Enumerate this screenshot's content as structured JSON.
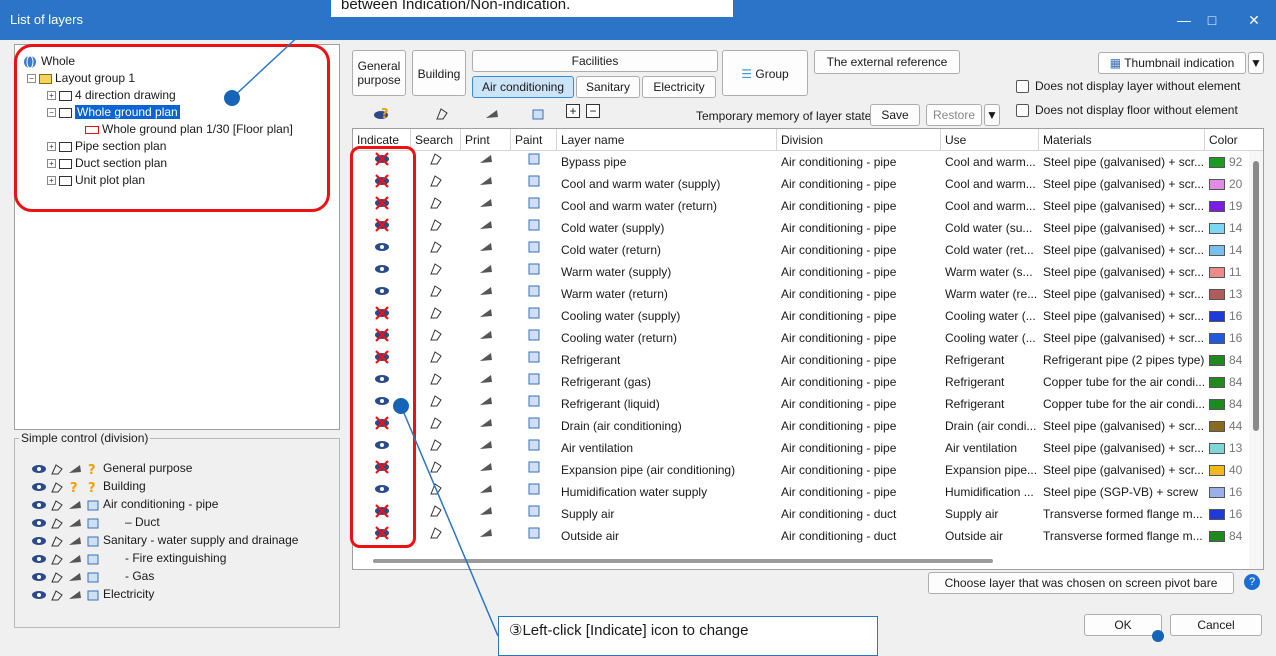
{
  "window": {
    "title": "List of layers",
    "minimize": "—",
    "maximize": "□",
    "close": "✕"
  },
  "callouts": {
    "top": "between Indication/Non-indication.",
    "bottom": "③Left-click [Indicate] icon to change"
  },
  "tree": {
    "items": [
      {
        "label": "Whole",
        "level": 0
      },
      {
        "label": "Layout group 1",
        "level": 1
      },
      {
        "label": "4 direction drawing",
        "level": 2
      },
      {
        "label": "Whole ground plan",
        "level": 2,
        "selected": true
      },
      {
        "label": "Whole ground plan 1/30 [Floor plan]",
        "level": 3
      },
      {
        "label": "Pipe section plan",
        "level": 2
      },
      {
        "label": "Duct section plan",
        "level": 2
      },
      {
        "label": "Unit plot plan",
        "level": 2
      }
    ]
  },
  "simple_control": {
    "legend": "Simple control (division)",
    "rows": [
      "General purpose",
      "Building",
      "Air conditioning - pipe",
      "– Duct",
      "Sanitary - water supply and drainage",
      "- Fire extinguishing",
      "- Gas",
      "Electricity"
    ]
  },
  "toolbar": {
    "general_purpose": "General purpose",
    "building": "Building",
    "facilities": "Facilities",
    "air_conditioning": "Air conditioning",
    "sanitary": "Sanitary",
    "electricity": "Electricity",
    "group": "Group",
    "external_reference": "The external reference",
    "thumbnail": "Thumbnail indication",
    "no_layer_without_element": "Does not display layer without element",
    "no_floor_without_element": "Does not display floor without element",
    "temp_memory": "Temporary memory of layer state",
    "save": "Save",
    "restore": "Restore"
  },
  "table": {
    "headers": [
      "Indicate",
      "Search",
      "Print",
      "Paint",
      "Layer name",
      "Division",
      "Use",
      "Materials",
      "Color"
    ],
    "rows": [
      {
        "indicate": "off",
        "name": "Bypass pipe",
        "division": "Air conditioning - pipe",
        "use": "Cool and warm...",
        "materials": "Steel pipe (galvanised) + scr...",
        "color": "#1e9a1e",
        "num": "92"
      },
      {
        "indicate": "off",
        "name": "Cool and warm water (supply)",
        "division": "Air conditioning - pipe",
        "use": "Cool and warm...",
        "materials": "Steel pipe (galvanised) + scr...",
        "color": "#e28ce6",
        "num": "20"
      },
      {
        "indicate": "off",
        "name": "Cool and warm water (return)",
        "division": "Air conditioning - pipe",
        "use": "Cool and warm...",
        "materials": "Steel pipe (galvanised) + scr...",
        "color": "#7a1ee6",
        "num": "19"
      },
      {
        "indicate": "off",
        "name": "Cold water (supply)",
        "division": "Air conditioning - pipe",
        "use": "Cold water (su...",
        "materials": "Steel pipe (galvanised) + scr...",
        "color": "#7fd6f2",
        "num": "14"
      },
      {
        "indicate": "on",
        "name": "Cold water (return)",
        "division": "Air conditioning - pipe",
        "use": "Cold water (ret...",
        "materials": "Steel pipe (galvanised) + scr...",
        "color": "#7ac0ee",
        "num": "14"
      },
      {
        "indicate": "on",
        "name": "Warm water (supply)",
        "division": "Air conditioning - pipe",
        "use": "Warm water (s...",
        "materials": "Steel pipe (galvanised) + scr...",
        "color": "#f08a8a",
        "num": "11"
      },
      {
        "indicate": "on",
        "name": "Warm water (return)",
        "division": "Air conditioning - pipe",
        "use": "Warm water (re...",
        "materials": "Steel pipe (galvanised) + scr...",
        "color": "#b35a5a",
        "num": "13"
      },
      {
        "indicate": "off",
        "name": "Cooling water (supply)",
        "division": "Air conditioning - pipe",
        "use": "Cooling water (...",
        "materials": "Steel pipe (galvanised) + scr...",
        "color": "#1e3ad9",
        "num": "16"
      },
      {
        "indicate": "off",
        "name": "Cooling water (return)",
        "division": "Air conditioning - pipe",
        "use": "Cooling water (...",
        "materials": "Steel pipe (galvanised) + scr...",
        "color": "#1e5ad9",
        "num": "16"
      },
      {
        "indicate": "off",
        "name": "Refrigerant",
        "division": "Air conditioning - pipe",
        "use": "Refrigerant",
        "materials": "Refrigerant pipe (2 pipes type)",
        "color": "#1e8a1e",
        "num": "84"
      },
      {
        "indicate": "on",
        "name": "Refrigerant (gas)",
        "division": "Air conditioning - pipe",
        "use": "Refrigerant",
        "materials": "Copper tube for the air condi...",
        "color": "#1e8a1e",
        "num": "84"
      },
      {
        "indicate": "on",
        "name": "Refrigerant (liquid)",
        "division": "Air conditioning - pipe",
        "use": "Refrigerant",
        "materials": "Copper tube for the air condi...",
        "color": "#1e8a1e",
        "num": "84"
      },
      {
        "indicate": "off",
        "name": "Drain (air conditioning)",
        "division": "Air conditioning - pipe",
        "use": "Drain (air condi...",
        "materials": "Steel pipe (galvanised) + scr...",
        "color": "#8a6a1e",
        "num": "44"
      },
      {
        "indicate": "on",
        "name": "Air ventilation",
        "division": "Air conditioning - pipe",
        "use": "Air ventilation",
        "materials": "Steel pipe (galvanised) + scr...",
        "color": "#7fd6d6",
        "num": "13"
      },
      {
        "indicate": "off",
        "name": "Expansion pipe (air conditioning)",
        "division": "Air conditioning - pipe",
        "use": "Expansion pipe...",
        "materials": "Steel pipe (galvanised) + scr...",
        "color": "#f2b81e",
        "num": "40"
      },
      {
        "indicate": "on",
        "name": "Humidification water supply",
        "division": "Air conditioning - pipe",
        "use": "Humidification ...",
        "materials": "Steel pipe (SGP-VB) + screw",
        "color": "#9ab0ea",
        "num": "16"
      },
      {
        "indicate": "off",
        "name": "Supply air",
        "division": "Air conditioning - duct",
        "use": "Supply air",
        "materials": "Transverse formed flange m...",
        "color": "#1e3ad9",
        "num": "16"
      },
      {
        "indicate": "off",
        "name": "Outside air",
        "division": "Air conditioning - duct",
        "use": "Outside air",
        "materials": "Transverse formed flange m...",
        "color": "#1e8a1e",
        "num": "84"
      }
    ]
  },
  "footer": {
    "choose_layer": "Choose layer that was chosen on screen pivot bare",
    "ok": "OK",
    "cancel": "Cancel"
  }
}
